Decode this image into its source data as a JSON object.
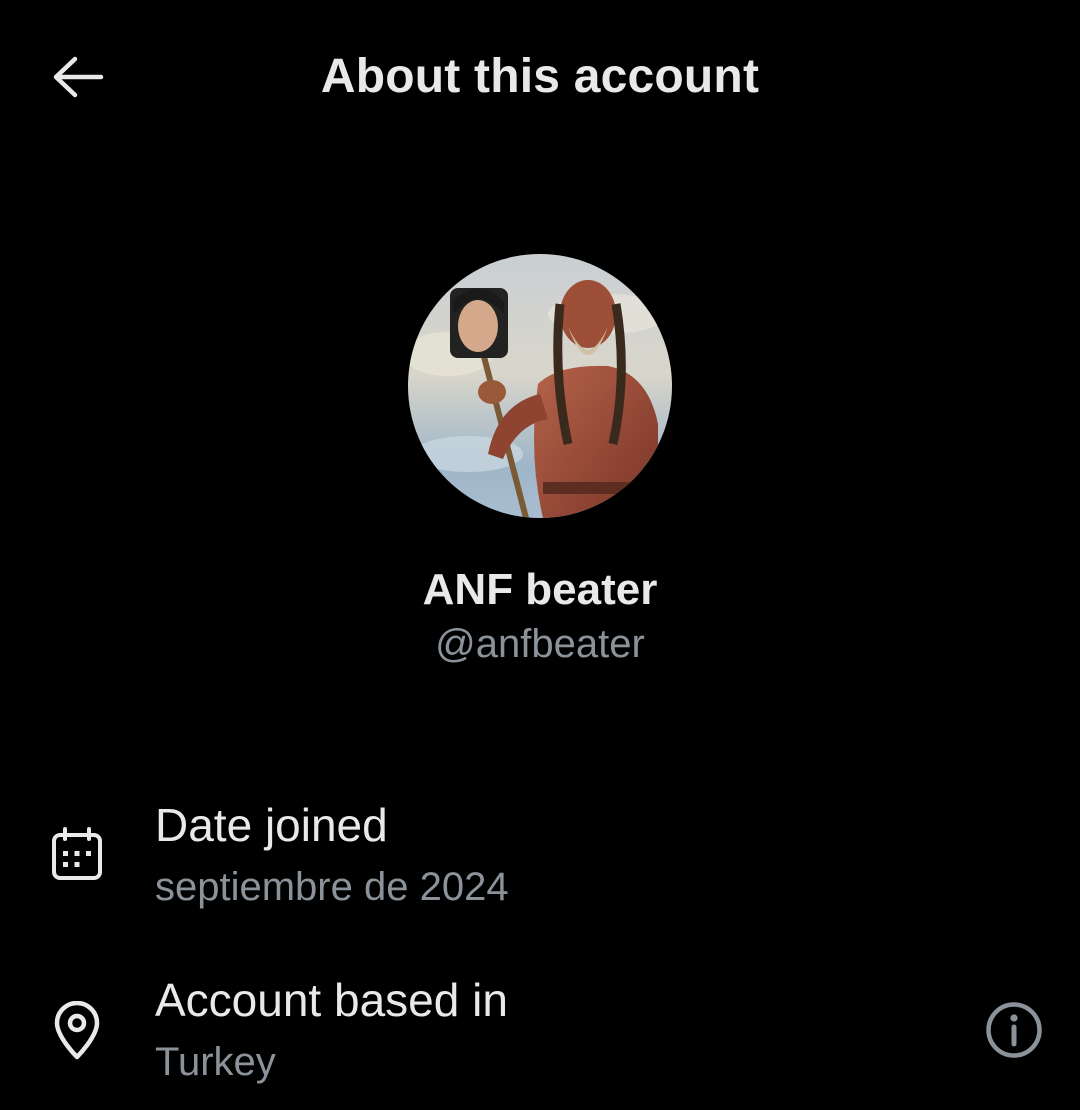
{
  "header": {
    "title": "About this account",
    "back_icon": "arrow-left-icon"
  },
  "profile": {
    "display_name": "ANF beater",
    "handle": "@anfbeater",
    "avatar_description_icon": "profile-avatar"
  },
  "details": [
    {
      "icon": "calendar-icon",
      "label": "Date joined",
      "value": "septiembre de 2024"
    },
    {
      "icon": "location-pin-icon",
      "label": "Account based in",
      "value": "Turkey",
      "action_icon": "info-icon"
    }
  ],
  "colors": {
    "background": "#000000",
    "primary_text": "#e7e9ea",
    "secondary_text": "#8b9299",
    "icon": "#e7e9ea"
  }
}
